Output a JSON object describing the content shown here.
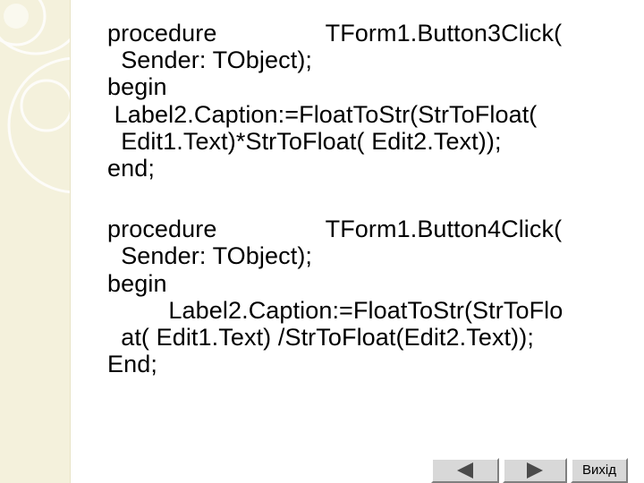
{
  "slide": {
    "lines": [
      "procedure                TForm1.Button3Click(",
      "  Sender: TObject);",
      "begin",
      " Label2.Caption:=FloatToStr(StrToFloat(",
      "  Edit1.Text)*StrToFloat( Edit2.Text));",
      "end;",
      "",
      "procedure                TForm1.Button4Click(",
      "  Sender: TObject);",
      "begin",
      "         Label2.Caption:=FloatToStr(StrToFlo",
      "  at( Edit1.Text) /StrToFloat(Edit2.Text));",
      "End;"
    ]
  },
  "navigation": {
    "prev_icon": "triangle-left-icon",
    "next_icon": "triangle-right-icon",
    "exit_label": "Вихід"
  },
  "colors": {
    "side_panel": "#f4f1dc",
    "text": "#000000",
    "nav_button": "#d8d8d8"
  }
}
